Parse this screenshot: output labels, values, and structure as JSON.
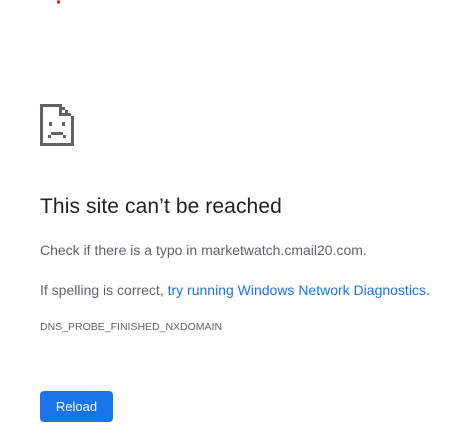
{
  "colors": {
    "accent": "#1a73e8",
    "title": "#202124",
    "body_text": "#5f6368",
    "indicator_dot": "#d93025"
  },
  "icon": "sad-page-icon",
  "error": {
    "title": "This site can’t be reached",
    "typo_prefix": "Check if there is a typo in ",
    "typo_domain": "marketwatch.cmail20.com",
    "typo_suffix": ".",
    "spelling_prefix": "If spelling is correct, ",
    "diagnostics_link": "try running Windows Network Diagnostics",
    "spelling_suffix": ".",
    "code": "DNS_PROBE_FINISHED_NXDOMAIN"
  },
  "actions": {
    "reload_label": "Reload"
  }
}
